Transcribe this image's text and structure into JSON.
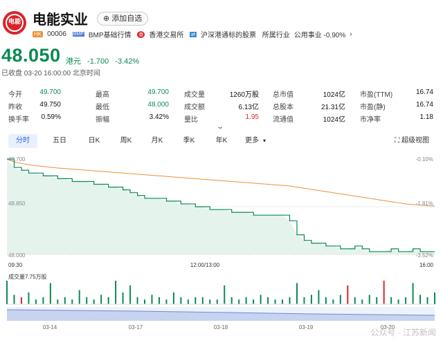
{
  "header": {
    "logo_text": "电能",
    "name": "电能实业",
    "add_favorite": "添加自选",
    "market_tag": "HK",
    "code": "00006",
    "bmp_tag": "BMP",
    "bmp_label": "BMP基础行情",
    "exchange_label": "香港交易所",
    "connect_label": "沪深港通标的股票",
    "industry_label": "所属行业",
    "industry_value": "公用事业 -0.90%"
  },
  "quote": {
    "price": "48.050",
    "currency": "港元",
    "change": "-1.700",
    "change_pct": "-3.42%",
    "status": "已收盘 03-20 16:00:00 北京时间"
  },
  "stats": [
    [
      {
        "l": "今开",
        "v": "49.700",
        "c": "green"
      },
      {
        "l": "最高",
        "v": "49.700",
        "c": "green"
      },
      {
        "l": "成交量",
        "v": "1260万股",
        "c": ""
      },
      {
        "l": "总市值",
        "v": "1024亿",
        "c": ""
      },
      {
        "l": "市盈(TTM)",
        "v": "16.74",
        "c": ""
      }
    ],
    [
      {
        "l": "昨收",
        "v": "49.750",
        "c": ""
      },
      {
        "l": "最低",
        "v": "48.000",
        "c": "green"
      },
      {
        "l": "成交额",
        "v": "6.13亿",
        "c": ""
      },
      {
        "l": "总股本",
        "v": "21.31亿",
        "c": ""
      },
      {
        "l": "市盈(静)",
        "v": "16.74",
        "c": ""
      }
    ],
    [
      {
        "l": "换手率",
        "v": "0.59%",
        "c": ""
      },
      {
        "l": "振幅",
        "v": "3.42%",
        "c": ""
      },
      {
        "l": "量比",
        "v": "1.95",
        "c": "red"
      },
      {
        "l": "流通值",
        "v": "1024亿",
        "c": ""
      },
      {
        "l": "市净率",
        "v": "1.18",
        "c": ""
      }
    ]
  ],
  "tabs": [
    "分时",
    "五日",
    "日K",
    "周K",
    "月K",
    "季K",
    "年K",
    "更多"
  ],
  "super_view": "超级视图",
  "colors": {
    "down": "#0a8a52",
    "up": "#d9252a",
    "avg": "#e8913a",
    "accent": "#2b63d9"
  },
  "chart_data": {
    "type": "line",
    "price_ticks": [
      "49.700",
      "48.850",
      "48.000"
    ],
    "pct_ticks": [
      "-0.10%",
      "-1.81%",
      "-3.52%"
    ],
    "time_ticks": [
      "09:30",
      "12:00/13:00",
      "16:00"
    ],
    "volume_label": "成交量7.75万股",
    "overview_dates": [
      "03-14",
      "03-17",
      "03-18",
      "03-19",
      "03-20"
    ],
    "ylim": [
      48.0,
      49.7
    ],
    "price": [
      49.7,
      49.55,
      49.5,
      49.45,
      49.45,
      49.4,
      49.4,
      49.35,
      49.35,
      49.3,
      49.3,
      49.3,
      49.25,
      49.25,
      49.2,
      49.2,
      49.15,
      49.1,
      49.05,
      49.0,
      49.0,
      49.0,
      48.95,
      48.95,
      48.9,
      48.9,
      48.85,
      48.85,
      48.8,
      48.8,
      48.8,
      48.75,
      48.75,
      48.75,
      48.7,
      48.7,
      48.7,
      48.7,
      48.7,
      48.6,
      48.35,
      48.25,
      48.2,
      48.2,
      48.15,
      48.15,
      48.1,
      48.1,
      48.15,
      48.1,
      48.05,
      48.05,
      48.05,
      48.1,
      48.05,
      48.05,
      48.1,
      48.05,
      48.05,
      48.05
    ],
    "avg": [
      49.7,
      49.65,
      49.62,
      49.6,
      49.58,
      49.57,
      49.55,
      49.54,
      49.53,
      49.52,
      49.51,
      49.5,
      49.49,
      49.48,
      49.47,
      49.46,
      49.45,
      49.44,
      49.43,
      49.42,
      49.41,
      49.4,
      49.39,
      49.38,
      49.37,
      49.36,
      49.35,
      49.34,
      49.33,
      49.32,
      49.31,
      49.3,
      49.29,
      49.28,
      49.27,
      49.26,
      49.25,
      49.24,
      49.23,
      49.22,
      49.2,
      49.18,
      49.16,
      49.14,
      49.12,
      49.1,
      49.08,
      49.06,
      49.04,
      49.02,
      49.0,
      48.98,
      48.96,
      48.94,
      48.92,
      48.9,
      48.89,
      48.88,
      48.87,
      48.86
    ],
    "volume": [
      10,
      4,
      3,
      5,
      2,
      3,
      9,
      2,
      3,
      2,
      6,
      3,
      2,
      4,
      3,
      10,
      5,
      8,
      3,
      2,
      4,
      3,
      2,
      5,
      3,
      2,
      3,
      3,
      2,
      2,
      8,
      3,
      2,
      3,
      2,
      4,
      3,
      2,
      2,
      3,
      9,
      3,
      4,
      6,
      3,
      2,
      4,
      8,
      3,
      2,
      4,
      3,
      10,
      3,
      2,
      3,
      9,
      4,
      3,
      5
    ],
    "volume_up": [
      false,
      false,
      true,
      false,
      false,
      false,
      false,
      false,
      false,
      false,
      false,
      false,
      false,
      false,
      false,
      false,
      false,
      false,
      false,
      false,
      false,
      false,
      false,
      false,
      false,
      false,
      false,
      false,
      false,
      false,
      false,
      false,
      false,
      false,
      false,
      false,
      false,
      false,
      false,
      false,
      false,
      false,
      false,
      false,
      false,
      false,
      false,
      true,
      false,
      false,
      false,
      false,
      true,
      false,
      false,
      false,
      false,
      false,
      false,
      false
    ],
    "watermark": "公众号 · 江苏新闻"
  }
}
